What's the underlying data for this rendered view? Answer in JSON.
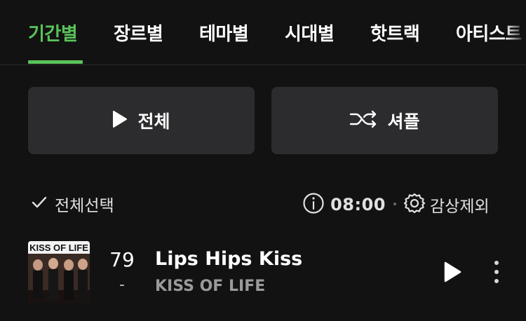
{
  "tabs": [
    {
      "label": "기간별",
      "active": true
    },
    {
      "label": "장르별",
      "active": false
    },
    {
      "label": "테마별",
      "active": false
    },
    {
      "label": "시대별",
      "active": false
    },
    {
      "label": "핫트랙",
      "active": false
    },
    {
      "label": "아티스트",
      "active": false
    }
  ],
  "actions": {
    "play_all_label": "전체",
    "shuffle_label": "셔플"
  },
  "toolbar": {
    "select_all_label": "전체선택",
    "duration": "08:00",
    "exclude_label": "감상제외"
  },
  "tracks": [
    {
      "rank": "79",
      "rank_change": "-",
      "title": "Lips Hips Kiss",
      "artist": "KISS OF LIFE",
      "cover_text": "KISS OF LIFE"
    }
  ],
  "colors": {
    "accent": "#5ac35a",
    "background": "#121212",
    "button_bg": "#2c2c2e"
  }
}
